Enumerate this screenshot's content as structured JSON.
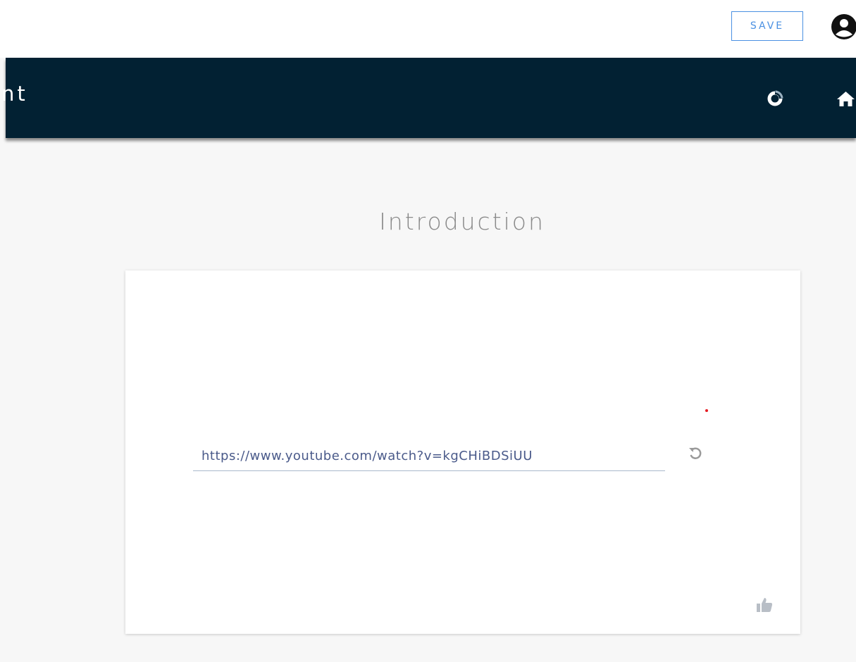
{
  "header": {
    "save_label": "SAVE",
    "profile_icon": "user-circle-icon"
  },
  "nav": {
    "title": "nt",
    "icons": [
      "progress-icon",
      "home-icon"
    ]
  },
  "main": {
    "section_title": "Introduction",
    "video_url_value": "https://www.youtube.com/watch?v=kgCHiBDSiUU",
    "undo_icon": "undo-icon",
    "like_icon": "thumbs-up-icon"
  },
  "colors": {
    "nav_background": "#022133",
    "accent": "#4a90e2",
    "required_marker": "#e51c23"
  }
}
